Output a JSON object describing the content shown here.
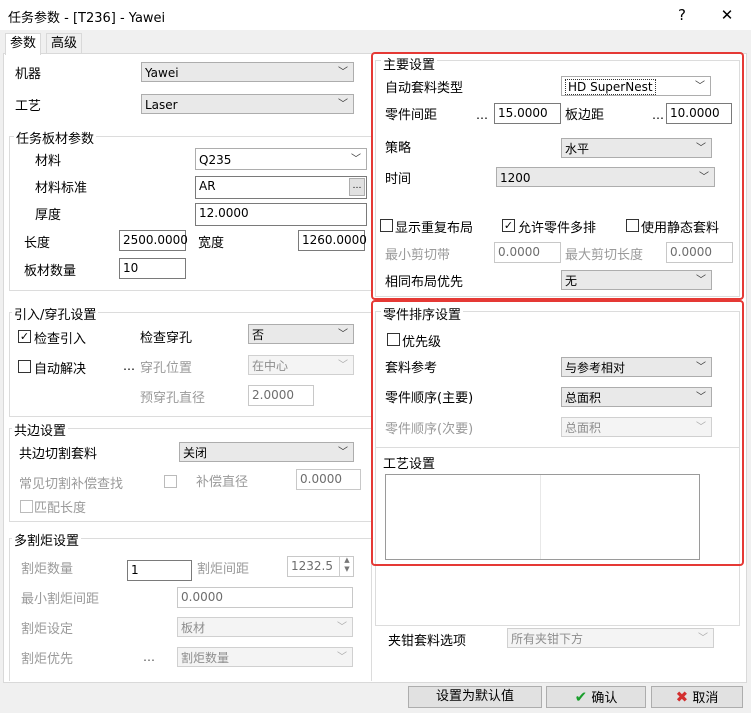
{
  "window": {
    "title": "任务参数 - [T236] - Yawei",
    "help": "?",
    "close": "✕"
  },
  "tabs": [
    {
      "label": "参数"
    },
    {
      "label": "高级"
    }
  ],
  "machine": {
    "label": "机器",
    "value": "Yawei"
  },
  "process": {
    "label": "工艺",
    "value": "Laser"
  },
  "sheet": {
    "title": "任务板材参数",
    "material_label": "材料",
    "material_value": "Q235",
    "standard_label": "材料标准",
    "standard_value": "AR",
    "thickness_label": "厚度",
    "thickness_value": "12.0000",
    "length_label": "长度",
    "length_value": "2500.0000",
    "width_label": "宽度",
    "width_value": "1260.0000",
    "count_label": "板材数量",
    "count_value": "10"
  },
  "leadin": {
    "title": "引入/穿孔设置",
    "check_leadin": "检查引入",
    "check_pierce": "检查穿孔",
    "pierce_value": "否",
    "auto_solve": "自动解决",
    "pierce_pos": "穿孔位置",
    "pierce_pos_value": "在中心",
    "prepierce": "预穿孔直径",
    "prepierce_value": "2.0000"
  },
  "common": {
    "title": "共边设置",
    "cut_label": "共边切割套料",
    "cut_value": "关闭",
    "comp_search": "常见切割补偿查找",
    "comp_dia": "补偿直径",
    "comp_value": "0.0000",
    "match_len": "匹配长度"
  },
  "torch": {
    "title": "多割炬设置",
    "count_label": "割炬数量",
    "count_value": "1",
    "spacing_label": "割炬间距",
    "spacing_value": "1232.5",
    "min_spacing_label": "最小割炬间距",
    "min_spacing_value": "0.0000",
    "setting_label": "割炬设定",
    "setting_value": "板材",
    "priority_label": "割炬优先",
    "priority_value": "割炬数量"
  },
  "main": {
    "title": "主要设置",
    "auto_type_label": "自动套料类型",
    "auto_type_value": "HD SuperNest",
    "part_gap_label": "零件间距",
    "part_gap_value": "15.0000",
    "edge_label": "板边距",
    "edge_value": "10.0000",
    "strategy_label": "策略",
    "strategy_value": "水平",
    "time_label": "时间",
    "time_value": "1200",
    "show_repeat": "显示重复布局",
    "allow_multi": "允许零件多排",
    "use_static": "使用静态套料",
    "min_cut_label": "最小剪切带",
    "min_cut_value": "0.0000",
    "max_cut_label": "最大剪切长度",
    "max_cut_value": "0.0000",
    "same_layout_label": "相同布局优先",
    "same_layout_value": "无"
  },
  "sort": {
    "title": "零件排序设置",
    "priority": "优先级",
    "ref_label": "套料参考",
    "ref_value": "与参考相对",
    "order1_label": "零件顺序(主要)",
    "order1_value": "总面积",
    "order2_label": "零件顺序(次要)",
    "order2_value": "总面积"
  },
  "craft": {
    "title": "工艺设置"
  },
  "clamp": {
    "label": "夹钳套料选项",
    "value": "所有夹钳下方"
  },
  "buttons": {
    "default": "设置为默认值",
    "ok": "确认",
    "cancel": "取消"
  },
  "colors": {
    "highlight": "#e53935",
    "ok_check": "#1a9e2c",
    "cancel_x": "#d32f2f"
  }
}
